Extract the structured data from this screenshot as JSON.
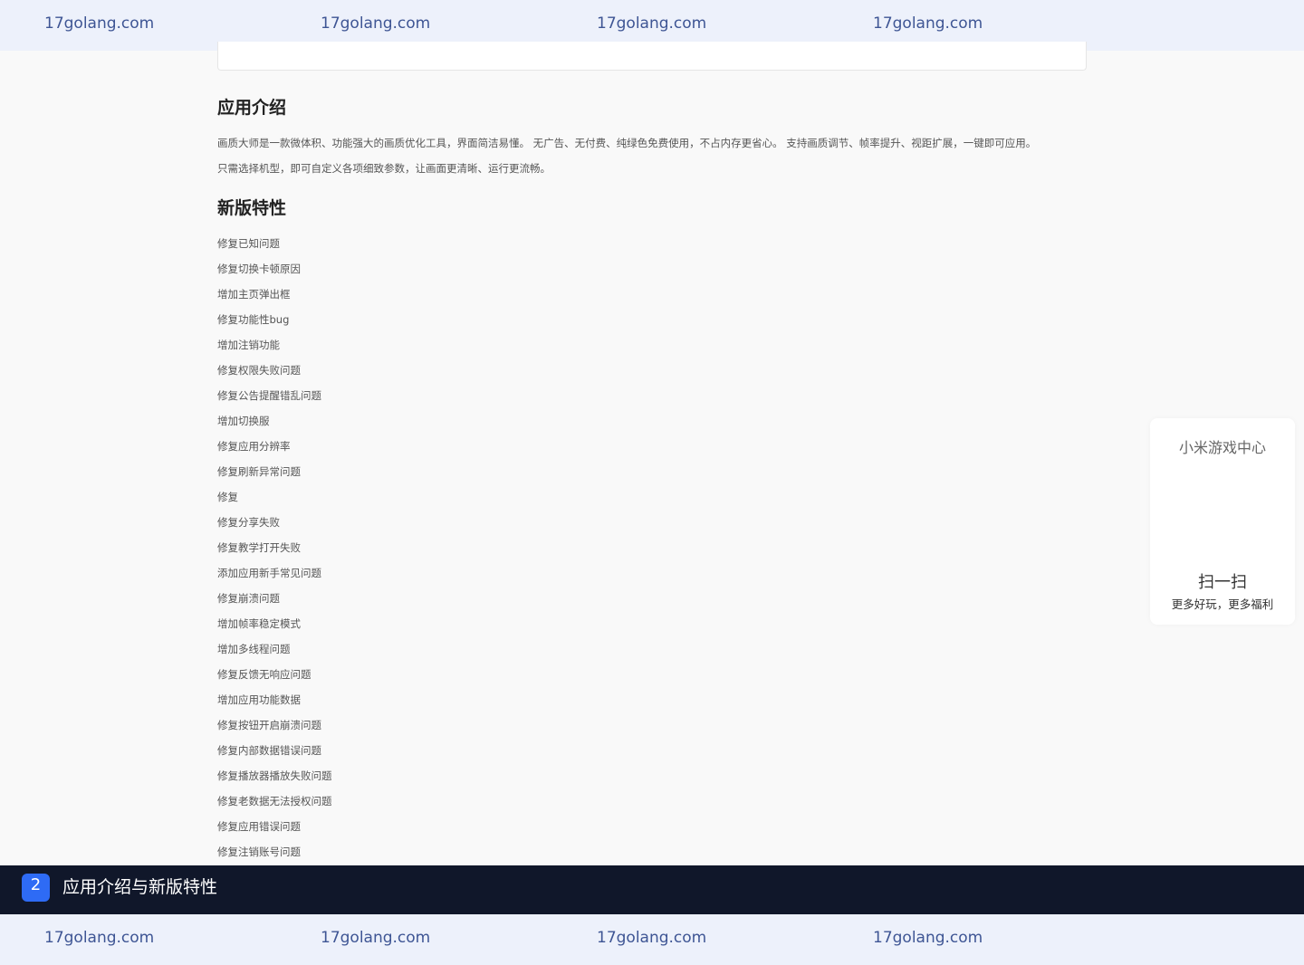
{
  "watermark": {
    "text": "17golang.com"
  },
  "intro": {
    "title": "应用介绍",
    "lines": [
      "画质大师是一款微体积、功能强大的画质优化工具，界面简洁易懂。 无广告、无付费、纯绿色免费使用，不占内存更省心。 支持画质调节、帧率提升、视距扩展，一键即可应用。",
      "只需选择机型，即可自定义各项细致参数，让画面更清晰、运行更流畅。"
    ]
  },
  "features": {
    "title": "新版特性",
    "items": [
      "修复已知问题",
      "修复切换卡顿原因",
      "增加主页弹出框",
      "修复功能性bug",
      "增加注销功能",
      "修复权限失败问题",
      "修复公告提醒错乱问题",
      "增加切换服",
      "修复应用分辨率",
      "修复刷新异常问题",
      "修复",
      "修复分享失败",
      "修复教学打开失败",
      "添加应用新手常见问题",
      "修复崩溃问题",
      "增加帧率稳定模式",
      "增加多线程问题",
      "修复反馈无响应问题",
      "增加应用功能数据",
      "修复按钮开启崩溃问题",
      "修复内部数据错误问题",
      "修复播放器播放失败问题",
      "修复老数据无法授权问题",
      "修复应用错误问题",
      "修复注销账号问题"
    ]
  },
  "qr_panel": {
    "title": "小米游戏中心",
    "scan": "扫一扫",
    "subtitle": "更多好玩，更多福利"
  },
  "caption": {
    "number": "2",
    "text": "应用介绍与新版特性",
    "badge_color": "#2e6bf5"
  }
}
